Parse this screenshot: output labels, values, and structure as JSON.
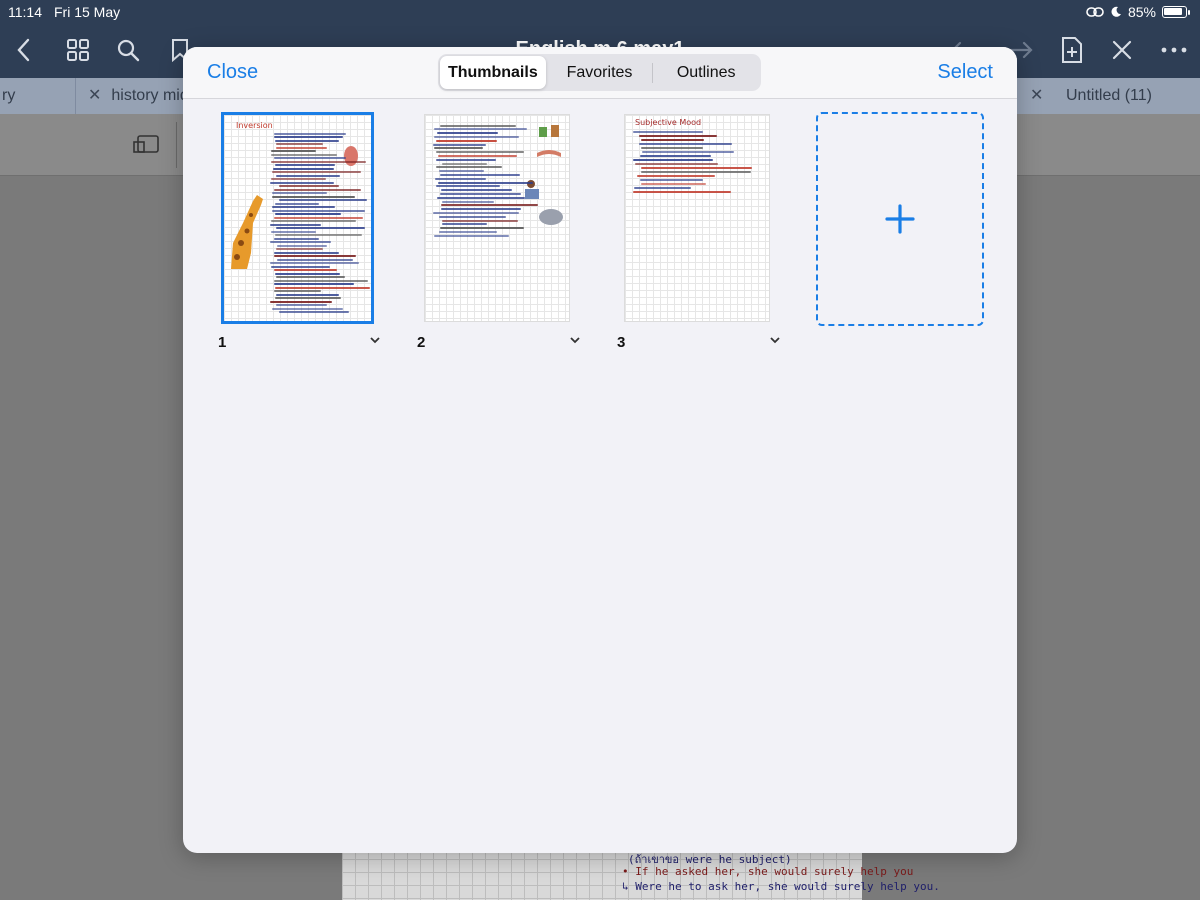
{
  "status_bar": {
    "time": "11:14",
    "date": "Fri 15 May",
    "battery": "85%"
  },
  "document": {
    "title": "English m.6 may1"
  },
  "tabs": [
    {
      "label": "ry"
    },
    {
      "label": "history mid"
    },
    {
      "label": ""
    },
    {
      "label": "Untitled (11)"
    }
  ],
  "modal": {
    "close_label": "Close",
    "select_label": "Select",
    "segments": [
      "Thumbnails",
      "Favorites",
      "Outlines"
    ],
    "active_segment": "Thumbnails"
  },
  "pages": [
    {
      "number": "1",
      "title": "Inversion",
      "selected": true
    },
    {
      "number": "2",
      "title": "",
      "selected": false
    },
    {
      "number": "3",
      "title": "Subjective Mood",
      "selected": false
    }
  ],
  "background_page": {
    "lines": [
      "(ถ้าเขาขอ were he subject)",
      "• If he asked her, she would surely help you",
      "↳ Were he to ask her, she would surely help you."
    ]
  },
  "colors": {
    "accent": "#1a7ee6",
    "toolbar": "#2e3e55",
    "tabs": "#96a2b4",
    "modal_bg": "#f2f2f7"
  },
  "icons": [
    "back-chevron-icon",
    "grid-icon",
    "search-icon",
    "bookmark-icon",
    "share-icon",
    "undo-icon",
    "redo-icon",
    "add-page-icon",
    "close-x-icon",
    "more-icon",
    "plus-icon",
    "chevron-down-icon"
  ]
}
